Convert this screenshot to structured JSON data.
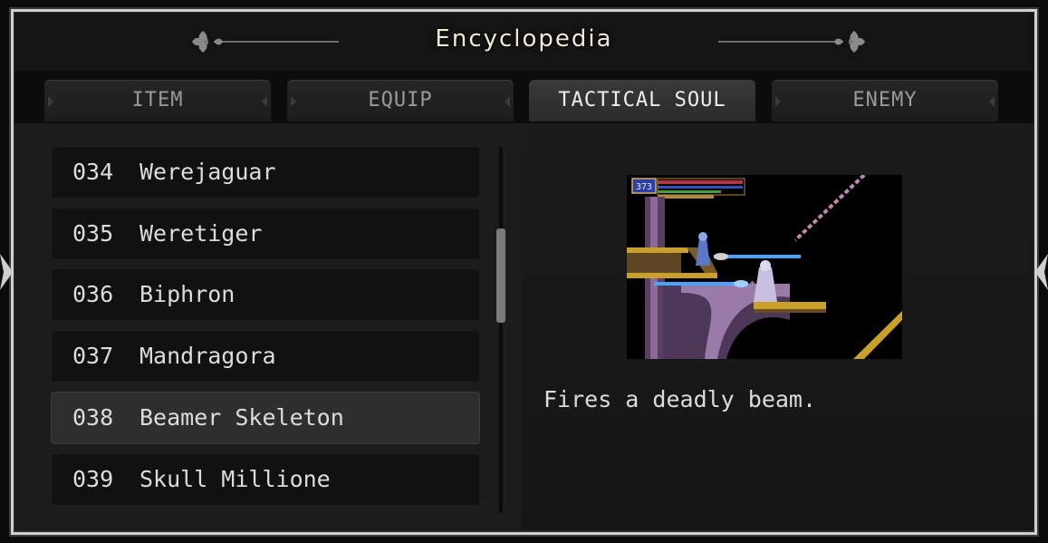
{
  "header": {
    "title": "Encyclopedia"
  },
  "tabs": [
    {
      "label": "ITEM",
      "active": false
    },
    {
      "label": "EQUIP",
      "active": false
    },
    {
      "label": "TACTICAL SOUL",
      "active": true
    },
    {
      "label": "ENEMY",
      "active": false
    }
  ],
  "list": {
    "items": [
      {
        "number": "034",
        "name": "Werejaguar"
      },
      {
        "number": "035",
        "name": "Weretiger"
      },
      {
        "number": "036",
        "name": "Biphron"
      },
      {
        "number": "037",
        "name": "Mandragora"
      },
      {
        "number": "038",
        "name": "Beamer Skeleton",
        "selected": true
      },
      {
        "number": "039",
        "name": "Skull Millione"
      }
    ]
  },
  "detail": {
    "hud_value": "373",
    "description": "Fires a deadly beam."
  },
  "colors": {
    "title": "#f1ead6",
    "frame_border": "#cfcfcf",
    "selected_row": "#2e2e2e",
    "row_bg": "#111111"
  },
  "icons": [
    "fleur-de-lis-ornament",
    "corner-ornament"
  ]
}
